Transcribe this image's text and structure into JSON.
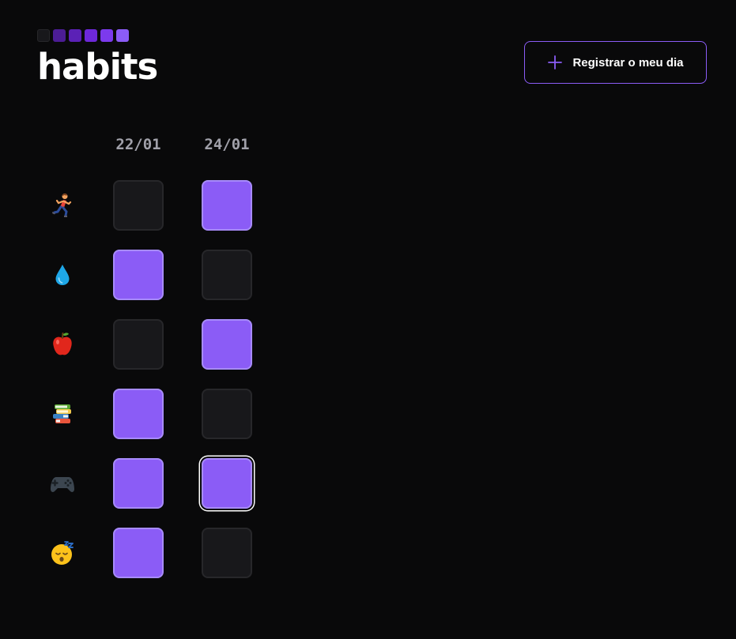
{
  "app": {
    "logo_title": "habits",
    "logo_colors": [
      "#18181b",
      "#4c1d95",
      "#5b21b6",
      "#6d28d9",
      "#7c3aed",
      "#8b5cf6"
    ],
    "accent_color": "#8b5cf6"
  },
  "header": {
    "register_button_label": "Registrar o meu dia",
    "register_button_icon": "plus-icon"
  },
  "dates": [
    "22/01",
    "24/01"
  ],
  "habits": [
    {
      "icon": "running-person-icon",
      "days": [
        false,
        true
      ]
    },
    {
      "icon": "water-droplet-icon",
      "days": [
        true,
        false
      ]
    },
    {
      "icon": "apple-icon",
      "days": [
        false,
        true
      ]
    },
    {
      "icon": "books-icon",
      "days": [
        true,
        false
      ]
    },
    {
      "icon": "game-controller-icon",
      "days": [
        true,
        true
      ]
    },
    {
      "icon": "sleeping-face-icon",
      "days": [
        true,
        false
      ]
    }
  ]
}
